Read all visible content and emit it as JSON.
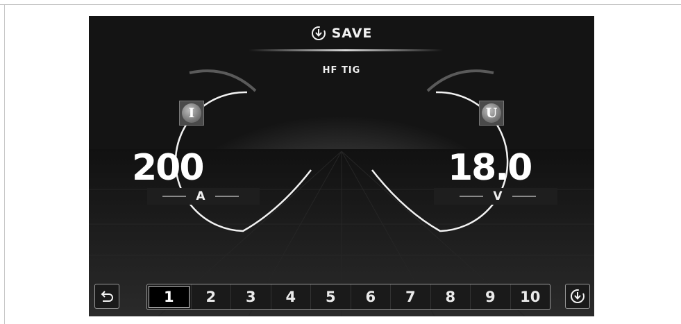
{
  "header": {
    "title": "SAVE",
    "icon": "save-download-icon"
  },
  "mode": {
    "label": "HF TIG"
  },
  "current": {
    "icon_letter": "I",
    "value": "200",
    "unit": "A"
  },
  "voltage": {
    "icon_letter": "U",
    "value": "18.0",
    "unit": "V"
  },
  "footer": {
    "back_icon": "back-arrow-icon",
    "save_icon": "save-download-icon",
    "channels": [
      "1",
      "2",
      "3",
      "4",
      "5",
      "6",
      "7",
      "8",
      "9",
      "10"
    ],
    "selected_channel": "1"
  },
  "colors": {
    "screen_bg": "#141414",
    "ring": "#f2f2f2",
    "text": "#ffffff"
  }
}
